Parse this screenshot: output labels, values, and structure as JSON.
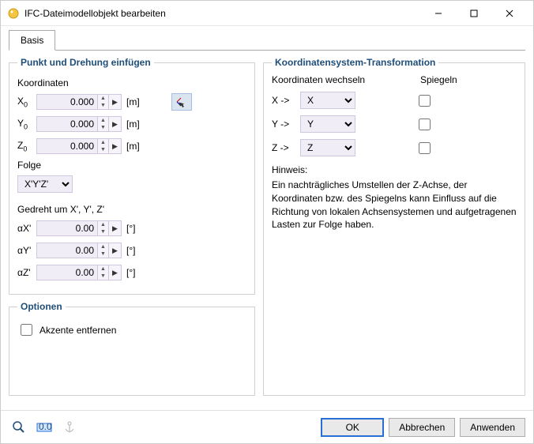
{
  "window": {
    "title": "IFC-Dateimodellobjekt bearbeiten"
  },
  "tabs": {
    "basis": "Basis"
  },
  "insert": {
    "legend": "Punkt und Drehung einfügen",
    "coord_label": "Koordinaten",
    "x_label": "X",
    "x_sub": "0",
    "x_value": "0.000",
    "x_unit": "[m]",
    "y_label": "Y",
    "y_sub": "0",
    "y_value": "0.000",
    "y_unit": "[m]",
    "z_label": "Z",
    "z_sub": "0",
    "z_value": "0.000",
    "z_unit": "[m]",
    "folge_label": "Folge",
    "folge_value": "X'Y'Z'",
    "rotate_label": "Gedreht um X', Y', Z'",
    "ax_label": "αX'",
    "ax_value": "0.00",
    "ax_unit": "[°]",
    "ay_label": "αY'",
    "ay_value": "0.00",
    "ay_unit": "[°]",
    "az_label": "αZ'",
    "az_value": "0.00",
    "az_unit": "[°]"
  },
  "cs": {
    "legend": "Koordinatensystem-Transformation",
    "swap_label": "Koordinaten wechseln",
    "mirror_label": "Spiegeln",
    "x_from": "X ->",
    "x_to": "X",
    "y_from": "Y ->",
    "y_to": "Y",
    "z_from": "Z ->",
    "z_to": "Z",
    "hint_title": "Hinweis:",
    "hint_text": "Ein nachträgliches Umstellen der Z-Achse, der Koordinaten bzw. des Spiegelns kann Einfluss auf die Richtung von lokalen Achsensystemen und aufgetragenen Lasten zur Folge haben."
  },
  "options": {
    "legend": "Optionen",
    "remove_accents": "Akzente entfernen"
  },
  "footer": {
    "ok": "OK",
    "cancel": "Abbrechen",
    "apply": "Anwenden"
  }
}
